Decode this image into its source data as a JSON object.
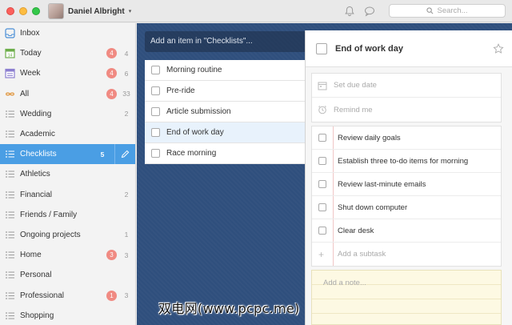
{
  "titlebar": {
    "user_name": "Daniel Albright",
    "caret": "▾",
    "search_placeholder": "Search..."
  },
  "sidebar": {
    "items": [
      {
        "label": "Inbox",
        "icon": "inbox-icon",
        "overdue": "",
        "count": ""
      },
      {
        "label": "Today",
        "icon": "calendar-today-icon",
        "overdue": "4",
        "count": "4"
      },
      {
        "label": "Week",
        "icon": "calendar-week-icon",
        "overdue": "4",
        "count": "6"
      },
      {
        "label": "All",
        "icon": "infinity-icon",
        "overdue": "4",
        "count": "33"
      },
      {
        "label": "Wedding",
        "icon": "list-icon",
        "overdue": "",
        "count": "2"
      },
      {
        "label": "Academic",
        "icon": "list-icon",
        "overdue": "",
        "count": ""
      },
      {
        "label": "Checklists",
        "icon": "list-icon",
        "overdue": "",
        "count": "5"
      },
      {
        "label": "Athletics",
        "icon": "list-icon",
        "overdue": "",
        "count": ""
      },
      {
        "label": "Financial",
        "icon": "list-icon",
        "overdue": "",
        "count": "2"
      },
      {
        "label": "Friends / Family",
        "icon": "list-icon",
        "overdue": "",
        "count": ""
      },
      {
        "label": "Ongoing projects",
        "icon": "list-icon",
        "overdue": "",
        "count": "1"
      },
      {
        "label": "Home",
        "icon": "list-icon",
        "overdue": "3",
        "count": "3"
      },
      {
        "label": "Personal",
        "icon": "list-icon",
        "overdue": "",
        "count": ""
      },
      {
        "label": "Professional",
        "icon": "list-icon",
        "overdue": "1",
        "count": "3"
      },
      {
        "label": "Shopping",
        "icon": "list-icon",
        "overdue": "",
        "count": ""
      }
    ],
    "active_index": 6
  },
  "main": {
    "add_placeholder": "Add an item in \"Checklists\"...",
    "tasks": [
      {
        "label": "Morning routine"
      },
      {
        "label": "Pre-ride"
      },
      {
        "label": "Article submission"
      },
      {
        "label": "End of work day"
      },
      {
        "label": "Race morning"
      }
    ],
    "selected_index": 3
  },
  "detail": {
    "title": "End of work day",
    "due_date": "Set due date",
    "reminder": "Remind me",
    "subtasks": [
      {
        "label": "Review daily goals"
      },
      {
        "label": "Establish three to-do items for morning"
      },
      {
        "label": "Review last-minute emails"
      },
      {
        "label": "Shut down computer"
      },
      {
        "label": "Clear desk"
      }
    ],
    "add_subtask": "Add a subtask",
    "note_placeholder": "Add a note..."
  },
  "watermark": "双电网(www.pcpc.me)",
  "colors": {
    "accent": "#4a9ee4",
    "background_blue": "#2f4f7d",
    "overdue_badge": "#f08a82",
    "note_yellow": "#fdf9e3"
  }
}
